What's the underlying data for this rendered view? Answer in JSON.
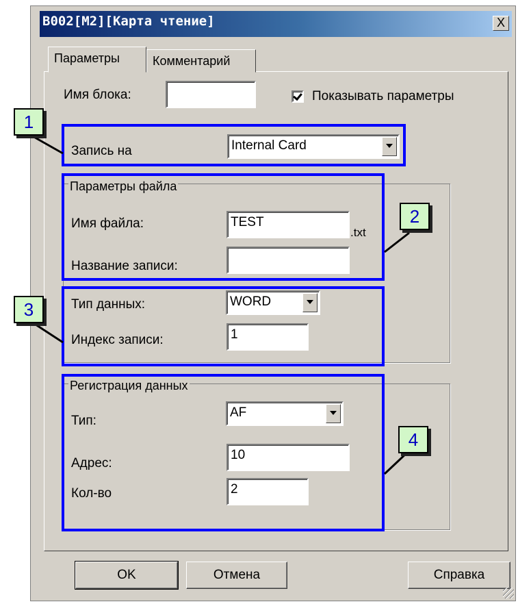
{
  "window": {
    "title": "B002[M2][Карта чтение]",
    "close_label": "X"
  },
  "tabs": [
    {
      "label": "Параметры"
    },
    {
      "label": "Комментарий"
    }
  ],
  "block_name": {
    "label": "Имя блока:",
    "value": ""
  },
  "show_params": {
    "label": "Показывать параметры",
    "checked": true
  },
  "write_to": {
    "label": "Запись на",
    "value": "Internal Card"
  },
  "file_params": {
    "title": "Параметры файла",
    "file_name_label": "Имя файла:",
    "file_name_value": "TEST",
    "extension": ".txt",
    "record_name_label": "Название записи:",
    "record_name_value": ""
  },
  "data_type": {
    "label": "Тип данных:",
    "value": "WORD"
  },
  "record_index": {
    "label": "Индекс записи:",
    "value": "1"
  },
  "data_registration": {
    "title": "Регистрация данных",
    "type_label": "Тип:",
    "type_value": "AF",
    "address_label": "Адрес:",
    "address_value": "10",
    "count_label": "Кол-во",
    "count_value": "2"
  },
  "callouts": [
    "1",
    "2",
    "3",
    "4"
  ],
  "buttons": {
    "ok": "OK",
    "cancel": "Отмена",
    "help": "Справка"
  },
  "colors": {
    "highlight": "#0000ff",
    "callout_bg": "#d2f7c8",
    "dialog_bg": "#d4d0c8"
  }
}
